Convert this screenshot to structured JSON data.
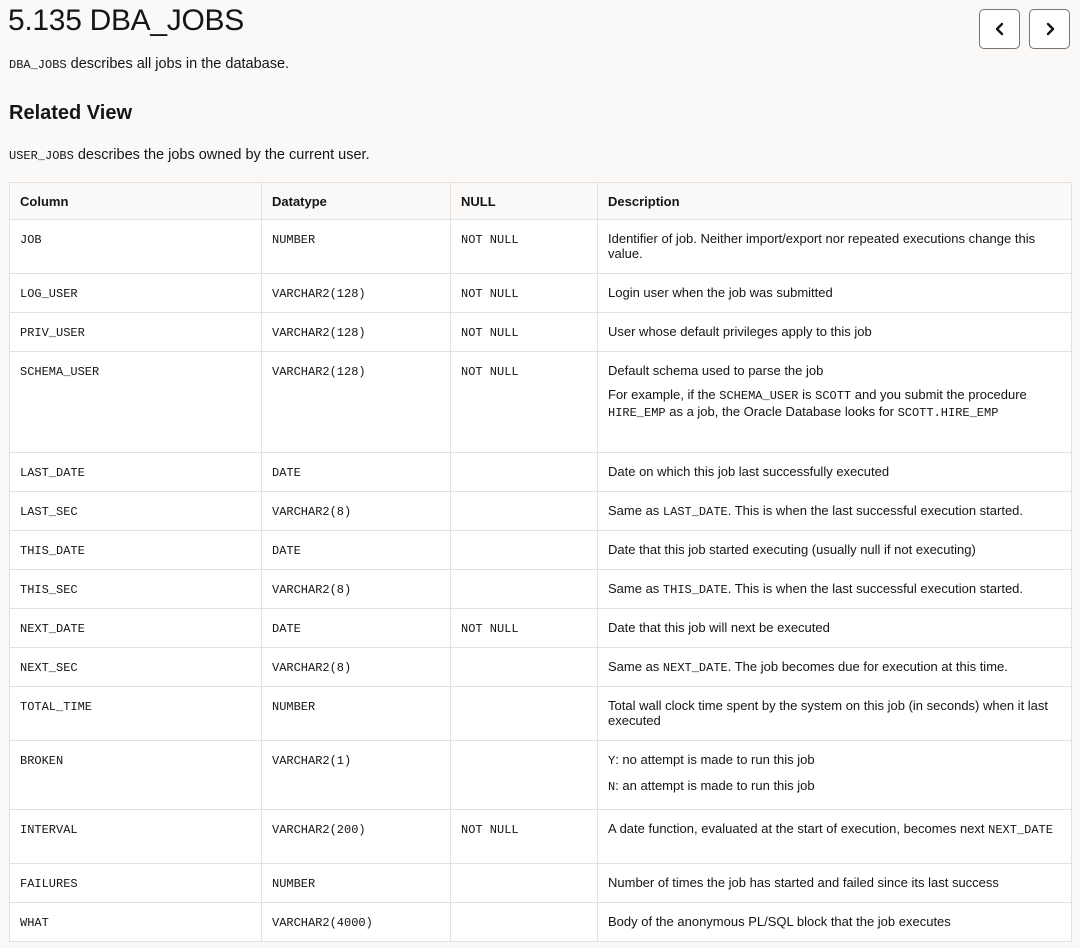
{
  "page": {
    "title": "5.135 DBA_JOBS",
    "intro_code": "DBA_JOBS",
    "intro_text": " describes all jobs in the database.",
    "related_heading": "Related View",
    "related_code": "USER_JOBS",
    "related_text": " describes the jobs owned by the current user."
  },
  "nav": {
    "prev_icon": "chevron-left-icon",
    "next_icon": "chevron-right-icon"
  },
  "table": {
    "headers": [
      "Column",
      "Datatype",
      "NULL",
      "Description"
    ],
    "rows": [
      {
        "column": "JOB",
        "datatype": "NUMBER",
        "null": "NOT NULL",
        "description": [
          [
            {
              "t": "Identifier of job. Neither import/export nor repeated executions change this value."
            }
          ]
        ]
      },
      {
        "column": "LOG_USER",
        "datatype": "VARCHAR2(128)",
        "null": "NOT NULL",
        "description": [
          [
            {
              "t": "Login user when the job was submitted"
            }
          ]
        ]
      },
      {
        "column": "PRIV_USER",
        "datatype": "VARCHAR2(128)",
        "null": "NOT NULL",
        "description": [
          [
            {
              "t": "User whose default privileges apply to this job"
            }
          ]
        ]
      },
      {
        "column": "SCHEMA_USER",
        "datatype": "VARCHAR2(128)",
        "null": "NOT NULL",
        "description": [
          [
            {
              "t": "Default schema used to parse the job"
            }
          ],
          [
            {
              "t": "For example, if the "
            },
            {
              "c": "SCHEMA_USER"
            },
            {
              "t": " is "
            },
            {
              "c": "SCOTT"
            },
            {
              "t": " and you submit the procedure "
            },
            {
              "c": "HIRE_EMP"
            },
            {
              "t": " as a job, the Oracle Database looks for "
            },
            {
              "c": "SCOTT.HIRE_EMP"
            }
          ]
        ]
      },
      {
        "column": "LAST_DATE",
        "datatype": "DATE",
        "null": "",
        "description": [
          [
            {
              "t": "Date on which this job last successfully executed"
            }
          ]
        ]
      },
      {
        "column": "LAST_SEC",
        "datatype": "VARCHAR2(8)",
        "null": "",
        "description": [
          [
            {
              "t": "Same as "
            },
            {
              "c": "LAST_DATE"
            },
            {
              "t": ". This is when the last successful execution started."
            }
          ]
        ]
      },
      {
        "column": "THIS_DATE",
        "datatype": "DATE",
        "null": "",
        "description": [
          [
            {
              "t": "Date that this job started executing (usually null if not executing)"
            }
          ]
        ]
      },
      {
        "column": "THIS_SEC",
        "datatype": "VARCHAR2(8)",
        "null": "",
        "description": [
          [
            {
              "t": "Same as "
            },
            {
              "c": "THIS_DATE"
            },
            {
              "t": ". This is when the last successful execution started."
            }
          ]
        ]
      },
      {
        "column": "NEXT_DATE",
        "datatype": "DATE",
        "null": "NOT NULL",
        "description": [
          [
            {
              "t": "Date that this job will next be executed"
            }
          ]
        ]
      },
      {
        "column": "NEXT_SEC",
        "datatype": "VARCHAR2(8)",
        "null": "",
        "description": [
          [
            {
              "t": "Same as "
            },
            {
              "c": "NEXT_DATE"
            },
            {
              "t": ". The job becomes due for execution at this time."
            }
          ]
        ]
      },
      {
        "column": "TOTAL_TIME",
        "datatype": "NUMBER",
        "null": "",
        "description": [
          [
            {
              "t": "Total wall clock time spent by the system on this job (in seconds) when it last executed"
            }
          ]
        ]
      },
      {
        "column": "BROKEN",
        "datatype": "VARCHAR2(1)",
        "null": "",
        "description": [
          [
            {
              "c": "Y"
            },
            {
              "t": ": no attempt is made to run this job"
            }
          ],
          [
            {
              "c": "N"
            },
            {
              "t": ": an attempt is made to run this job"
            }
          ]
        ]
      },
      {
        "column": "INTERVAL",
        "datatype": "VARCHAR2(200)",
        "null": "NOT NULL",
        "description": [
          [
            {
              "t": "A date function, evaluated at the start of execution, becomes next "
            },
            {
              "c": "NEXT_DATE"
            }
          ]
        ]
      },
      {
        "column": "FAILURES",
        "datatype": "NUMBER",
        "null": "",
        "description": [
          [
            {
              "t": "Number of times the job has started and failed since its last success"
            }
          ]
        ]
      },
      {
        "column": "WHAT",
        "datatype": "VARCHAR2(4000)",
        "null": "",
        "description": [
          [
            {
              "t": "Body of the anonymous PL/SQL block that the job executes"
            }
          ]
        ]
      }
    ]
  }
}
